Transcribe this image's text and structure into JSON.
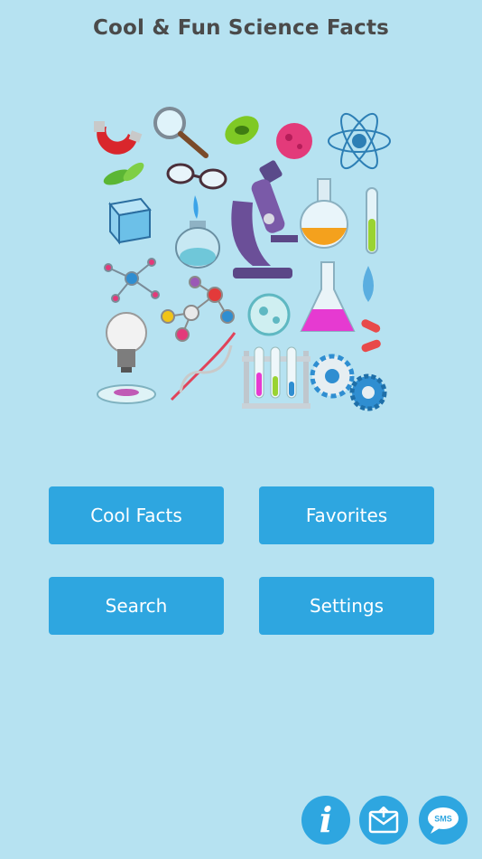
{
  "header": {
    "title": "Cool & Fun Science Facts"
  },
  "hero": {
    "icons": [
      "magnet-icon",
      "magnifier-icon",
      "bacteria-icon",
      "virus-icon",
      "atom-icon",
      "leaves-icon",
      "glasses-icon",
      "cube-icon",
      "burner-icon",
      "microscope-icon",
      "round-flask-icon",
      "test-tube-icon",
      "molecule-icon",
      "conical-flask-icon",
      "water-drop-icon",
      "lightbulb-icon",
      "dna-icon",
      "petri-dish-icon",
      "test-tube-rack-icon",
      "gear-icon",
      "pill-icon"
    ]
  },
  "menu": {
    "cool_facts": "Cool Facts",
    "favorites": "Favorites",
    "search": "Search",
    "settings": "Settings"
  },
  "footer": {
    "info_glyph": "i",
    "sms_label": "SMS"
  },
  "colors": {
    "background": "#b6e2f1",
    "accent": "#2ea6e0",
    "title": "#4a4a4a"
  }
}
